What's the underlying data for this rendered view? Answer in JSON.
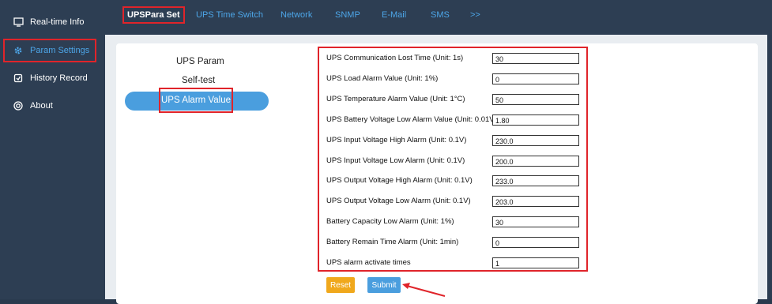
{
  "sidebar": {
    "items": [
      {
        "label": "Real-time Info",
        "icon": "monitor-icon"
      },
      {
        "label": "Param Settings",
        "icon": "gear-icon"
      },
      {
        "label": "History Record",
        "icon": "history-icon"
      },
      {
        "label": "About",
        "icon": "info-icon"
      }
    ]
  },
  "topnav": {
    "tabs": [
      "UPSPara Set",
      "UPS Time Switch",
      "Network",
      "SNMP",
      "E-Mail",
      "SMS",
      ">>"
    ]
  },
  "submenu": {
    "items": [
      "UPS Param",
      "Self-test",
      "UPS Alarm Value"
    ]
  },
  "form": {
    "rows": [
      {
        "label": "UPS Communication Lost Time (Unit: 1s)",
        "value": "30"
      },
      {
        "label": "UPS Load Alarm Value (Unit: 1%)",
        "value": "0"
      },
      {
        "label": "UPS Temperature Alarm Value (Unit: 1°C)",
        "value": "50"
      },
      {
        "label": "UPS Battery Voltage Low Alarm Value (Unit: 0.01V)",
        "value": "1.80"
      },
      {
        "label": "UPS Input Voltage High Alarm (Unit: 0.1V)",
        "value": "230.0"
      },
      {
        "label": "UPS Input Voltage Low Alarm (Unit: 0.1V)",
        "value": "200.0"
      },
      {
        "label": "UPS Output Voltage High Alarm (Unit: 0.1V)",
        "value": "233.0"
      },
      {
        "label": "UPS Output Voltage Low Alarm (Unit: 0.1V)",
        "value": "203.0"
      },
      {
        "label": "Battery Capacity Low Alarm (Unit: 1%)",
        "value": "30"
      },
      {
        "label": "Battery Remain Time Alarm (Unit: 1min)",
        "value": "0"
      },
      {
        "label": "UPS alarm activate times",
        "value": "1"
      }
    ]
  },
  "buttons": {
    "reset": "Reset",
    "submit": "Submit"
  },
  "colors": {
    "accent": "#4da6e8",
    "highlight": "#e0242a",
    "reset": "#f0a81c",
    "submit": "#4a9ede",
    "sidebar_bg": "#2d3e53"
  }
}
